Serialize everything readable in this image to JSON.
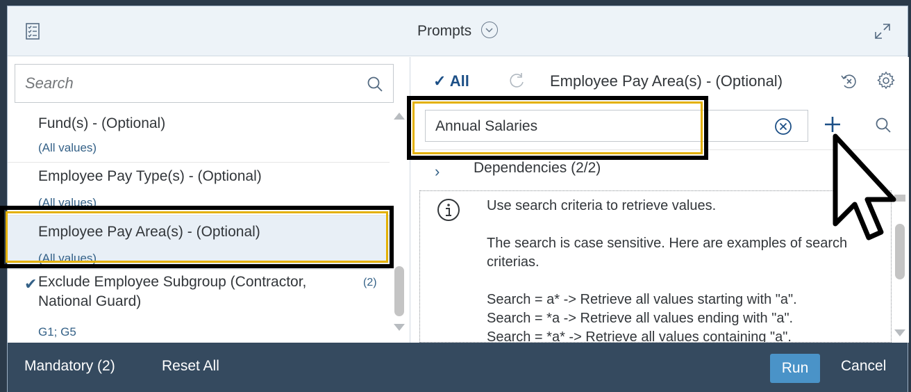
{
  "header": {
    "title": "Prompts"
  },
  "left": {
    "search_placeholder": "Search",
    "prompts": [
      {
        "label": "Fund(s) - (Optional)",
        "value": "(All values)"
      },
      {
        "label": "Employee Pay Type(s) - (Optional)",
        "value": "(All values)"
      },
      {
        "label": "Employee Pay Area(s) - (Optional)",
        "value": "(All values)"
      },
      {
        "label": "Exclude Employee Subgroup (Contractor, National Guard)",
        "value": "G1; G5",
        "count": "(2)"
      }
    ]
  },
  "right": {
    "all_label": "All",
    "title": "Employee Pay Area(s) - (Optional)",
    "value_input": "Annual Salaries",
    "dependencies": "Dependencies (2/2)",
    "info_lines": [
      "Use search criteria to retrieve values.",
      "The search is case sensitive. Here are examples of search criterias.",
      "Search = a* -> Retrieve all values starting with \"a\".",
      "Search = *a -> Retrieve all values ending with \"a\".",
      "Search = *a* -> Retrieve all values containing \"a\"."
    ]
  },
  "footer": {
    "mandatory": "Mandatory (2)",
    "reset": "Reset All",
    "run": "Run",
    "cancel": "Cancel"
  }
}
